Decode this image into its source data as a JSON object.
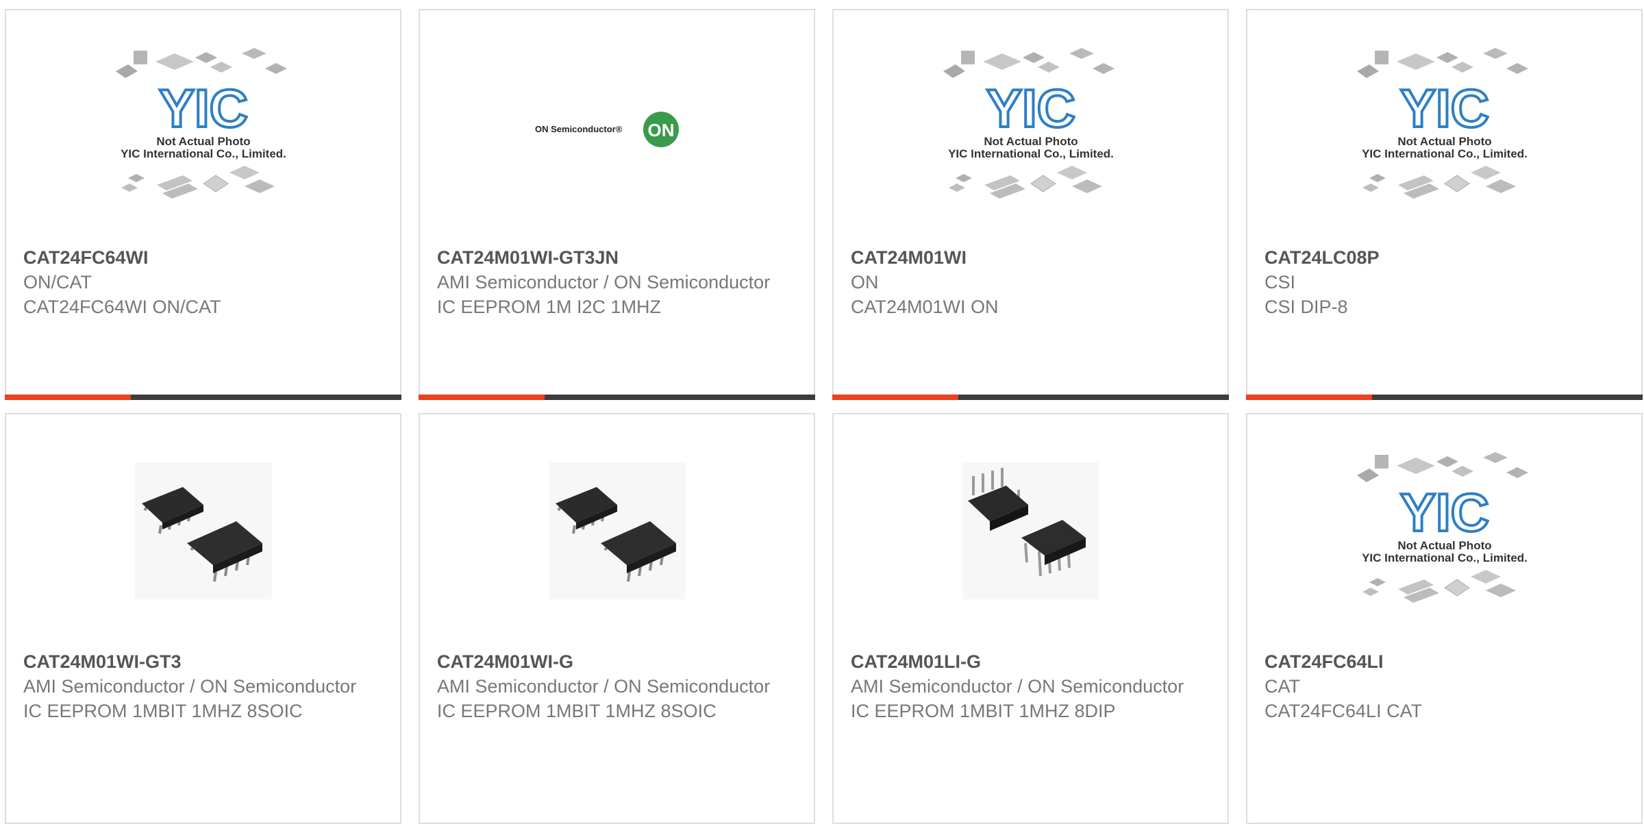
{
  "products": [
    {
      "part_number": "CAT24FC64WI",
      "manufacturer": "ON/CAT",
      "description": "CAT24FC64WI ON/CAT",
      "image": {
        "type": "placeholder-yic",
        "line1": "Not Actual Photo",
        "line2": "YIC International Co., Limited.",
        "logo": "YIC"
      }
    },
    {
      "part_number": "CAT24M01WI-GT3JN",
      "manufacturer": "AMI Semiconductor / ON Semiconductor",
      "description": "IC EEPROM 1M I2C 1MHZ",
      "image": {
        "type": "on-semi-logo",
        "brand_text": "ON Semiconductor®",
        "badge": "ON"
      }
    },
    {
      "part_number": "CAT24M01WI",
      "manufacturer": "ON",
      "description": "CAT24M01WI ON",
      "image": {
        "type": "placeholder-yic",
        "line1": "Not Actual Photo",
        "line2": "YIC International Co., Limited.",
        "logo": "YIC"
      }
    },
    {
      "part_number": "CAT24LC08P",
      "manufacturer": "CSI",
      "description": "CSI DIP-8",
      "image": {
        "type": "placeholder-yic",
        "line1": "Not Actual Photo",
        "line2": "YIC International Co., Limited.",
        "logo": "YIC"
      }
    },
    {
      "part_number": "CAT24M01WI-GT3",
      "manufacturer": "AMI Semiconductor / ON Semiconductor",
      "description": "IC EEPROM 1MBIT 1MHZ 8SOIC",
      "image": {
        "type": "soic-8-photo"
      }
    },
    {
      "part_number": "CAT24M01WI-G",
      "manufacturer": "AMI Semiconductor / ON Semiconductor",
      "description": "IC EEPROM 1MBIT 1MHZ 8SOIC",
      "image": {
        "type": "soic-8-photo"
      }
    },
    {
      "part_number": "CAT24M01LI-G",
      "manufacturer": "AMI Semiconductor / ON Semiconductor",
      "description": "IC EEPROM 1MBIT 1MHZ 8DIP",
      "image": {
        "type": "dip-8-photo"
      }
    },
    {
      "part_number": "CAT24FC64LI",
      "manufacturer": "CAT",
      "description": "CAT24FC64LI CAT",
      "image": {
        "type": "placeholder-yic",
        "line1": "Not Actual Photo",
        "line2": "YIC International Co., Limited.",
        "logo": "YIC"
      }
    }
  ],
  "colors": {
    "accent": "#e8421e",
    "bar": "#3d3d3d",
    "title_text": "#555555",
    "body_text": "#777777",
    "card_border": "#dedede",
    "yic_logo_blue": "#2f7fc4",
    "on_semi_green": "#3a9b4a"
  }
}
